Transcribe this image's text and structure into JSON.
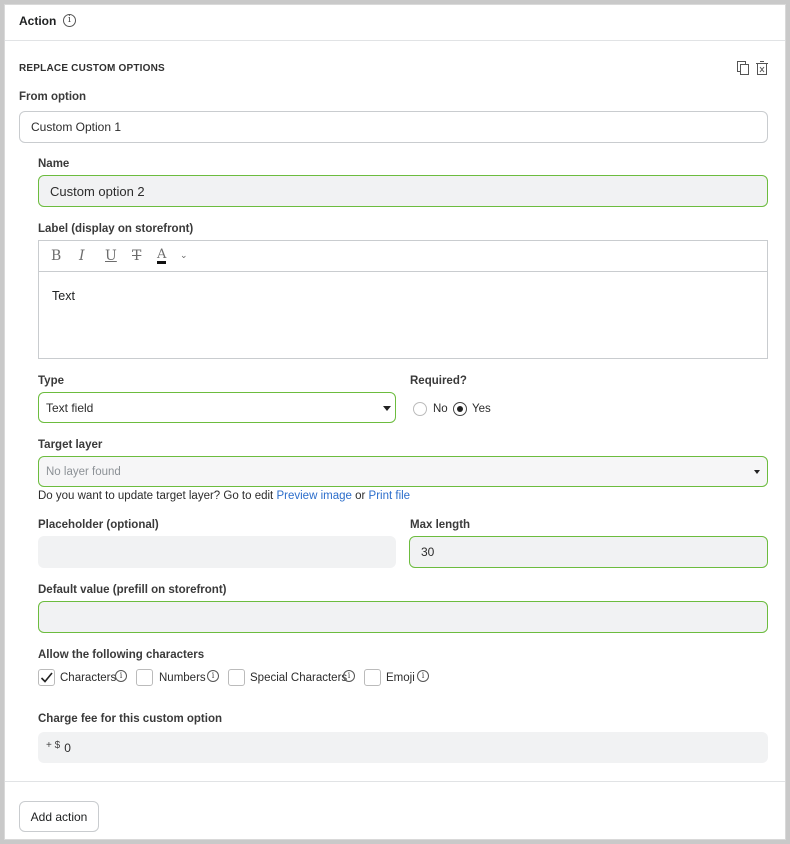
{
  "header": {
    "title": "Action"
  },
  "section": {
    "title": "REPLACE CUSTOM OPTIONS",
    "from_option_label": "From option",
    "from_option_value": "Custom Option 1"
  },
  "name": {
    "label": "Name",
    "value": "Custom option 2"
  },
  "label_editor": {
    "label": "Label (display on storefront)",
    "content": "Text",
    "toolbar": {
      "bold": "B",
      "italic": "I",
      "underline": "U",
      "strike": "T",
      "color": "A"
    }
  },
  "type": {
    "label": "Type",
    "value": "Text field"
  },
  "required": {
    "label": "Required?",
    "options": [
      "No",
      "Yes"
    ],
    "selected": "Yes"
  },
  "target_layer": {
    "label": "Target layer",
    "placeholder": "No layer found",
    "help_prefix": "Do you want to update target layer? Go to edit",
    "link_preview": "Preview image",
    "help_or": "or",
    "link_print": "Print file"
  },
  "placeholder_field": {
    "label": "Placeholder (optional)",
    "value": ""
  },
  "max_length": {
    "label": "Max length",
    "value": "30"
  },
  "default_value": {
    "label": "Default value (prefill on storefront)",
    "value": ""
  },
  "allow_chars": {
    "label": "Allow the following characters",
    "options": [
      {
        "label": "Characters",
        "checked": true
      },
      {
        "label": "Numbers",
        "checked": false
      },
      {
        "label": "Special Characters",
        "checked": false
      },
      {
        "label": "Emoji",
        "checked": false
      }
    ]
  },
  "charge_fee": {
    "label": "Charge fee for this custom option",
    "prefix": "+ $",
    "value": "0"
  },
  "footer": {
    "add_action": "Add action"
  },
  "colors": {
    "accent_green": "#6cbc3e",
    "link": "#2c6ecb"
  }
}
